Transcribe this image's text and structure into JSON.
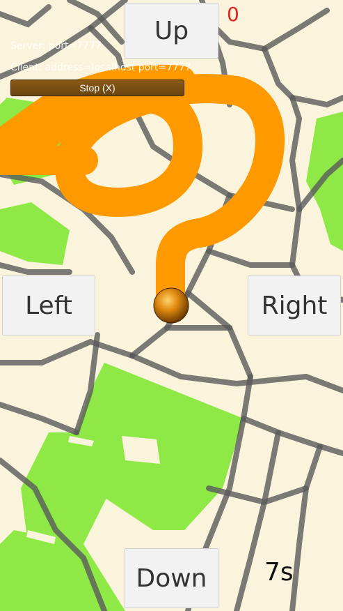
{
  "game": {
    "score": "0",
    "timer": "7s"
  },
  "controls": {
    "up_label": "Up",
    "down_label": "Down",
    "left_label": "Left",
    "right_label": "Right"
  },
  "network": {
    "server_label": "Server: port=7777",
    "client_label": "Client: address=localhost port=7777",
    "stop_label": "Stop (X)"
  },
  "colors": {
    "map_background": "#fbf4dc",
    "park": "#8ee845",
    "road": "#5a5a5a",
    "trail": "#ff9900",
    "score": "#e52222"
  }
}
